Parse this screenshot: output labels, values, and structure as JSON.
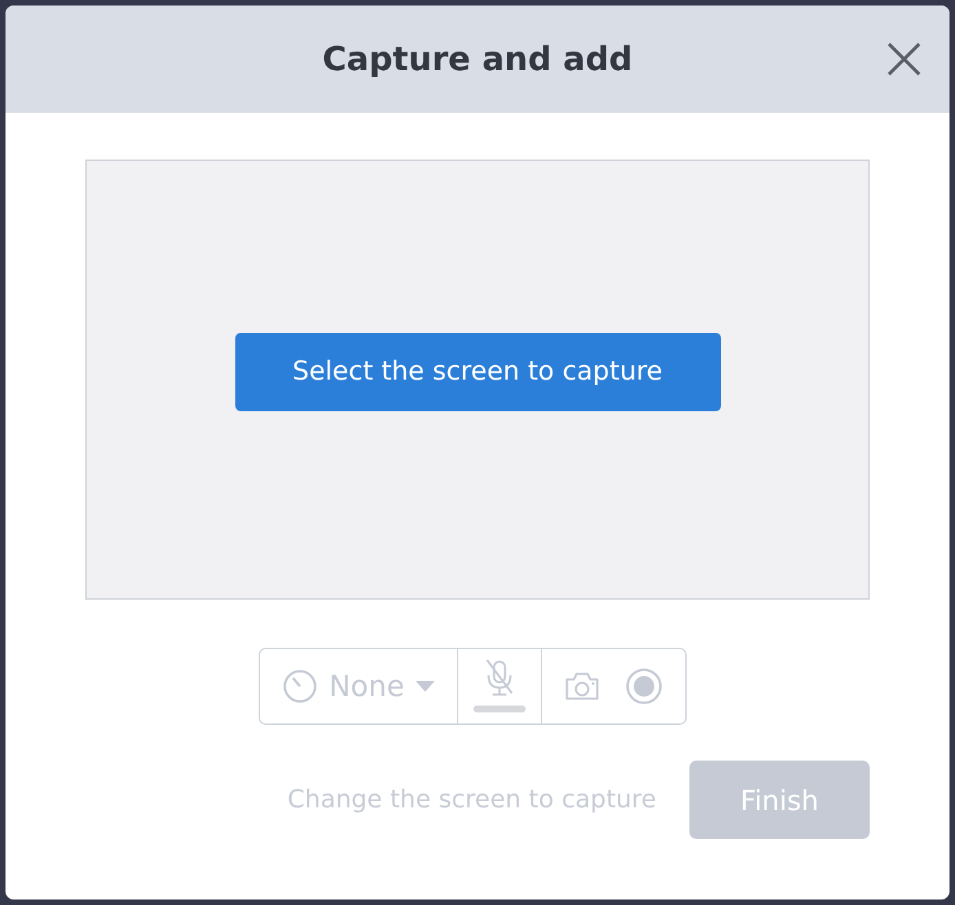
{
  "dialog": {
    "title": "Capture and add"
  },
  "preview": {
    "select_button": "Select the screen to capture"
  },
  "toolbar": {
    "disabled": true,
    "timer": "None",
    "mic_muted": true
  },
  "footer": {
    "change_link": {
      "label": "Change the screen to capture",
      "disabled": true
    },
    "finish_button": {
      "label": "Finish",
      "disabled": true
    }
  }
}
